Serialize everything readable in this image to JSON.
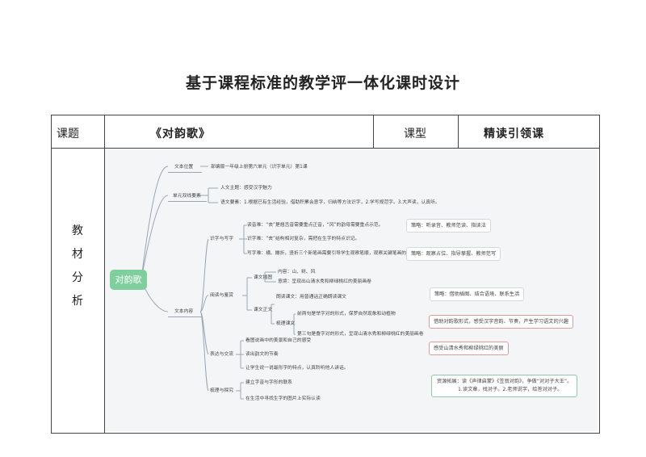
{
  "title": "基于课程标准的教学评一体化课时设计",
  "table": {
    "topic_label": "课题",
    "topic_value": "《对韵歌》",
    "type_label": "课型",
    "type_value": "精读引领课",
    "side_chars": [
      "教",
      "材",
      "分",
      "析"
    ]
  },
  "mindmap": {
    "root": "对韵歌",
    "b1": "文本位置",
    "b1_leaf": "部编版一年级上册第六单元（识字单元）第1课",
    "b2": "单元双线要素",
    "b2_humanist": "人文主题：感受汉字魅力",
    "b2_element": "语文要素：1.根据已有生活经验，借助积累会意字，归纳等方法识字，2.学写规范字。3.大声读，认真听。",
    "b3": "文本内容",
    "s_rw": "识字与写字",
    "rw_1": "读音难：“去”是翘舌音需要重点正音，“风”的韵母需要重点示范。",
    "rw_2": "识字难：“去”结构相对复杂，需把在生字的特点识记。",
    "rw_3": "写字难：横、撇折，竖折三个新笔画需要引导学生观察笔顺，观察关键笔画的位置。",
    "s_rr": "阅读与鉴赏",
    "rr_a": "课文插图",
    "rr_a1": "内容：山、树、风",
    "rr_a2": "意境：呈现出山清水秀和柳绿桃红的美丽画卷",
    "rr_b": "课文正文",
    "rr_b1": "朗读课文：用普通话正确朗读课文",
    "rr_b2": "梳理课文",
    "rr_b2a": "前两句是举字对的形式，保罗自然现象和动植物",
    "rr_b2b": "第三句是叠字对的形式，呈现山清水秀和柳绿桃红的美丽画卷",
    "s_ex": "表达与交流",
    "ex_1": "看图说画中的美景和自己的感受",
    "ex_2": "读出韵文的节奏",
    "ex_3": "让学生说一说最形字的特点，认真聆听他人讲话。",
    "s_in": "梳理与探究",
    "in_1": "建立字音与字形的联系",
    "in_2": "在生活中寻找生字的图片上实际认读",
    "notes": {
      "n1": "策略：听录音、教师范读、指读法",
      "n2": "策略：观察占位、指导孳握、教师范写",
      "n3": "策略：借助插图、结合语境、联系生活",
      "n4": "借助对韵歌形式，感受汉字音韵、节奏，产生学习语文的兴趣",
      "n5": "感受山清水秀和柳绿桃红的美丽",
      "n6_l1": "资源拓展：读《声律启蒙》《笠翁对韵》，争做“对对子大王”。",
      "n6_l2": "1.读文章，找对子。2.老师说字，给答对对子。"
    }
  }
}
